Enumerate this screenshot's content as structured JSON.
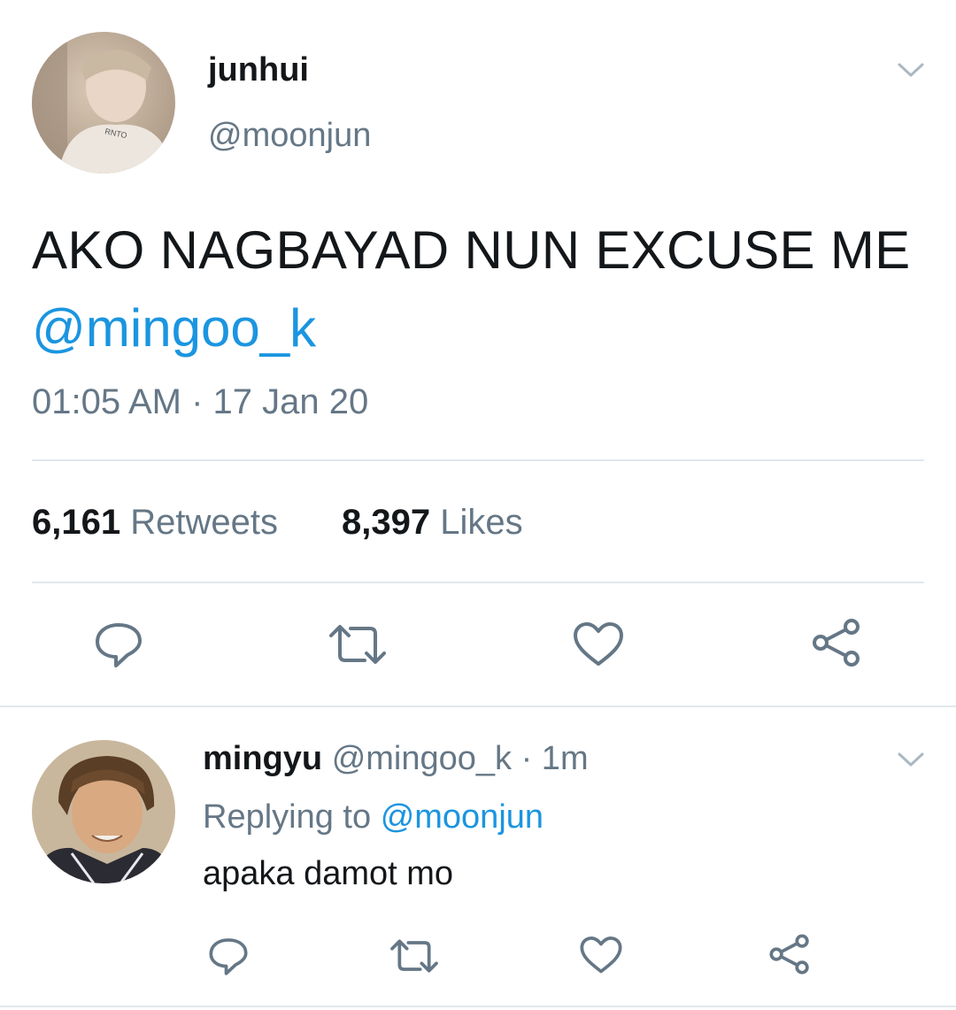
{
  "main_tweet": {
    "display_name": "junhui",
    "handle": "@moonjun",
    "text_line1": "AKO NAGBAYAD NUN EXCUSE ME",
    "text_mention": "@mingoo_k",
    "timestamp": "01:05 AM · 17 Jan 20",
    "retweets_count": "6,161",
    "retweets_label": "Retweets",
    "likes_count": "8,397",
    "likes_label": "Likes",
    "actions": [
      "reply-icon",
      "retweet-icon",
      "like-icon",
      "share-icon"
    ]
  },
  "reply_tweet": {
    "display_name": "mingyu",
    "handle": "@mingoo_k",
    "age": "· 1m",
    "replying_label": "Replying to",
    "replying_to": "@moonjun",
    "text": "apaka damot mo",
    "actions": [
      "reply-icon",
      "retweet-icon",
      "like-icon",
      "share-icon"
    ]
  },
  "colors": {
    "link": "#1b95e0",
    "secondary": "#657786",
    "divider": "#e1e8ed",
    "icon": "#657786",
    "text": "#14171a"
  }
}
